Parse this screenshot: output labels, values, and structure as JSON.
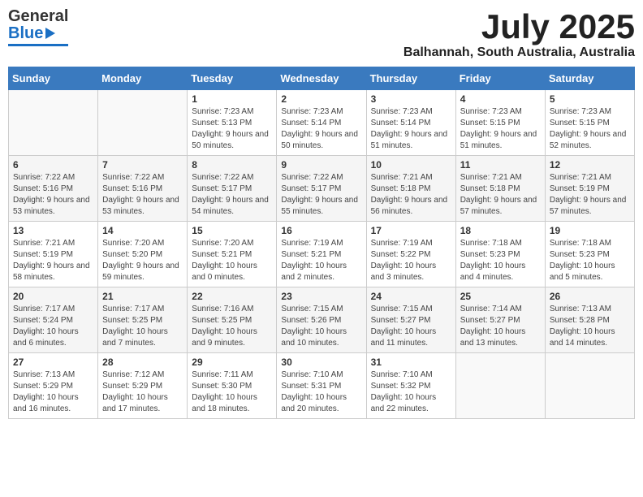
{
  "header": {
    "logo_general": "General",
    "logo_blue": "Blue",
    "month_year": "July 2025",
    "location": "Balhannah, South Australia, Australia"
  },
  "weekdays": [
    "Sunday",
    "Monday",
    "Tuesday",
    "Wednesday",
    "Thursday",
    "Friday",
    "Saturday"
  ],
  "weeks": [
    [
      {
        "day": "",
        "info": ""
      },
      {
        "day": "",
        "info": ""
      },
      {
        "day": "1",
        "info": "Sunrise: 7:23 AM\nSunset: 5:13 PM\nDaylight: 9 hours and 50 minutes."
      },
      {
        "day": "2",
        "info": "Sunrise: 7:23 AM\nSunset: 5:14 PM\nDaylight: 9 hours and 50 minutes."
      },
      {
        "day": "3",
        "info": "Sunrise: 7:23 AM\nSunset: 5:14 PM\nDaylight: 9 hours and 51 minutes."
      },
      {
        "day": "4",
        "info": "Sunrise: 7:23 AM\nSunset: 5:15 PM\nDaylight: 9 hours and 51 minutes."
      },
      {
        "day": "5",
        "info": "Sunrise: 7:23 AM\nSunset: 5:15 PM\nDaylight: 9 hours and 52 minutes."
      }
    ],
    [
      {
        "day": "6",
        "info": "Sunrise: 7:22 AM\nSunset: 5:16 PM\nDaylight: 9 hours and 53 minutes."
      },
      {
        "day": "7",
        "info": "Sunrise: 7:22 AM\nSunset: 5:16 PM\nDaylight: 9 hours and 53 minutes."
      },
      {
        "day": "8",
        "info": "Sunrise: 7:22 AM\nSunset: 5:17 PM\nDaylight: 9 hours and 54 minutes."
      },
      {
        "day": "9",
        "info": "Sunrise: 7:22 AM\nSunset: 5:17 PM\nDaylight: 9 hours and 55 minutes."
      },
      {
        "day": "10",
        "info": "Sunrise: 7:21 AM\nSunset: 5:18 PM\nDaylight: 9 hours and 56 minutes."
      },
      {
        "day": "11",
        "info": "Sunrise: 7:21 AM\nSunset: 5:18 PM\nDaylight: 9 hours and 57 minutes."
      },
      {
        "day": "12",
        "info": "Sunrise: 7:21 AM\nSunset: 5:19 PM\nDaylight: 9 hours and 57 minutes."
      }
    ],
    [
      {
        "day": "13",
        "info": "Sunrise: 7:21 AM\nSunset: 5:19 PM\nDaylight: 9 hours and 58 minutes."
      },
      {
        "day": "14",
        "info": "Sunrise: 7:20 AM\nSunset: 5:20 PM\nDaylight: 9 hours and 59 minutes."
      },
      {
        "day": "15",
        "info": "Sunrise: 7:20 AM\nSunset: 5:21 PM\nDaylight: 10 hours and 0 minutes."
      },
      {
        "day": "16",
        "info": "Sunrise: 7:19 AM\nSunset: 5:21 PM\nDaylight: 10 hours and 2 minutes."
      },
      {
        "day": "17",
        "info": "Sunrise: 7:19 AM\nSunset: 5:22 PM\nDaylight: 10 hours and 3 minutes."
      },
      {
        "day": "18",
        "info": "Sunrise: 7:18 AM\nSunset: 5:23 PM\nDaylight: 10 hours and 4 minutes."
      },
      {
        "day": "19",
        "info": "Sunrise: 7:18 AM\nSunset: 5:23 PM\nDaylight: 10 hours and 5 minutes."
      }
    ],
    [
      {
        "day": "20",
        "info": "Sunrise: 7:17 AM\nSunset: 5:24 PM\nDaylight: 10 hours and 6 minutes."
      },
      {
        "day": "21",
        "info": "Sunrise: 7:17 AM\nSunset: 5:25 PM\nDaylight: 10 hours and 7 minutes."
      },
      {
        "day": "22",
        "info": "Sunrise: 7:16 AM\nSunset: 5:25 PM\nDaylight: 10 hours and 9 minutes."
      },
      {
        "day": "23",
        "info": "Sunrise: 7:15 AM\nSunset: 5:26 PM\nDaylight: 10 hours and 10 minutes."
      },
      {
        "day": "24",
        "info": "Sunrise: 7:15 AM\nSunset: 5:27 PM\nDaylight: 10 hours and 11 minutes."
      },
      {
        "day": "25",
        "info": "Sunrise: 7:14 AM\nSunset: 5:27 PM\nDaylight: 10 hours and 13 minutes."
      },
      {
        "day": "26",
        "info": "Sunrise: 7:13 AM\nSunset: 5:28 PM\nDaylight: 10 hours and 14 minutes."
      }
    ],
    [
      {
        "day": "27",
        "info": "Sunrise: 7:13 AM\nSunset: 5:29 PM\nDaylight: 10 hours and 16 minutes."
      },
      {
        "day": "28",
        "info": "Sunrise: 7:12 AM\nSunset: 5:29 PM\nDaylight: 10 hours and 17 minutes."
      },
      {
        "day": "29",
        "info": "Sunrise: 7:11 AM\nSunset: 5:30 PM\nDaylight: 10 hours and 18 minutes."
      },
      {
        "day": "30",
        "info": "Sunrise: 7:10 AM\nSunset: 5:31 PM\nDaylight: 10 hours and 20 minutes."
      },
      {
        "day": "31",
        "info": "Sunrise: 7:10 AM\nSunset: 5:32 PM\nDaylight: 10 hours and 22 minutes."
      },
      {
        "day": "",
        "info": ""
      },
      {
        "day": "",
        "info": ""
      }
    ]
  ]
}
